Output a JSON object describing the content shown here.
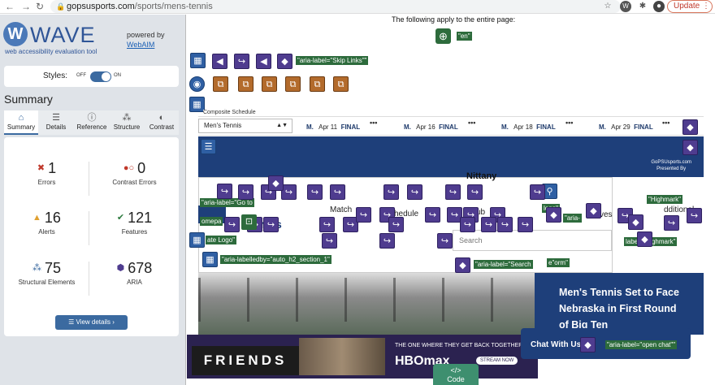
{
  "browser": {
    "url_host": "gopsusports.com",
    "url_path": "/sports/mens-tennis",
    "update_label": "Update",
    "profile_letter": "W"
  },
  "wave": {
    "title": "WAVE",
    "subtitle": "web accessibility evaluation tool",
    "powered_by": "powered by",
    "webaim": "WebAIM",
    "styles_label": "Styles:",
    "styles_off": "OFF",
    "styles_on": "ON",
    "summary_heading": "Summary",
    "tabs": [
      {
        "label": "Summary",
        "icon": "home-icon"
      },
      {
        "label": "Details",
        "icon": "list-icon"
      },
      {
        "label": "Reference",
        "icon": "info-icon"
      },
      {
        "label": "Structure",
        "icon": "structure-icon"
      },
      {
        "label": "Contrast",
        "icon": "contrast-icon"
      }
    ],
    "stats": {
      "errors": {
        "value": "1",
        "label": "Errors"
      },
      "contrast_errors": {
        "value": "0",
        "label": "Contrast Errors"
      },
      "alerts": {
        "value": "16",
        "label": "Alerts"
      },
      "features": {
        "value": "121",
        "label": "Features"
      },
      "structural": {
        "value": "75",
        "label": "Structural Elements"
      },
      "aria": {
        "value": "678",
        "label": "ARIA"
      }
    },
    "view_details": "View details ›"
  },
  "page": {
    "annotation_top": "The following apply to the entire page:",
    "lang_tag": "\"en\"",
    "skip_links_tag": "\"aria-label=\"Skip Links\"\"",
    "composite_schedule": "Composite Schedule",
    "select_value": "Men's Tennis",
    "games": [
      {
        "prefix": "M.",
        "date": "Apr 11",
        "status": "FINAL"
      },
      {
        "prefix": "M.",
        "date": "Apr 16",
        "status": "FINAL"
      },
      {
        "prefix": "M.",
        "date": "Apr 18",
        "status": "FINAL"
      },
      {
        "prefix": "M.",
        "date": "Apr 29",
        "status": "FINAL"
      }
    ],
    "gps_label_1": "GoPSUsports.com",
    "gps_label_2": "Presented By",
    "nittany": "Nittany",
    "match": "Match",
    "schedule_frag": "chedule",
    "tennis_frag": "nnis",
    "search_placeholder": "Search",
    "highmark_1": "\"Highmark\"",
    "highmark_2": "label=\"Highmark\"",
    "logo_tag": "logo\"",
    "aria_tag": "\"aria-",
    "additional_frag": "dditional",
    "ves_frag": "ves",
    "ub_frag": "ub",
    "omepa_frag": "omepa",
    "ate_logo": "ate Logo\"",
    "aria_label_go": "\"aria-label=\"Go to",
    "labelledby_tag": "\"aria-labelledby=\"auto_h2_section_1\"",
    "search_tag": "\"aria-label=\"Search",
    "form_tag": "e\"orm\"",
    "news_title": "Men's Tennis Set to Face Nebraska in First Round of Big Ten",
    "ad_friends": "FRIENDS",
    "ad_tagline": "THE ONE WHERE THEY GET BACK TOGETHER",
    "ad_hbo": "HBOmax",
    "ad_stream": "STREAM NOW",
    "chat_label": "Chat With Us",
    "open_chat_tag": "\"aria-label=\"open chat\"\"",
    "code_label": "Code"
  }
}
